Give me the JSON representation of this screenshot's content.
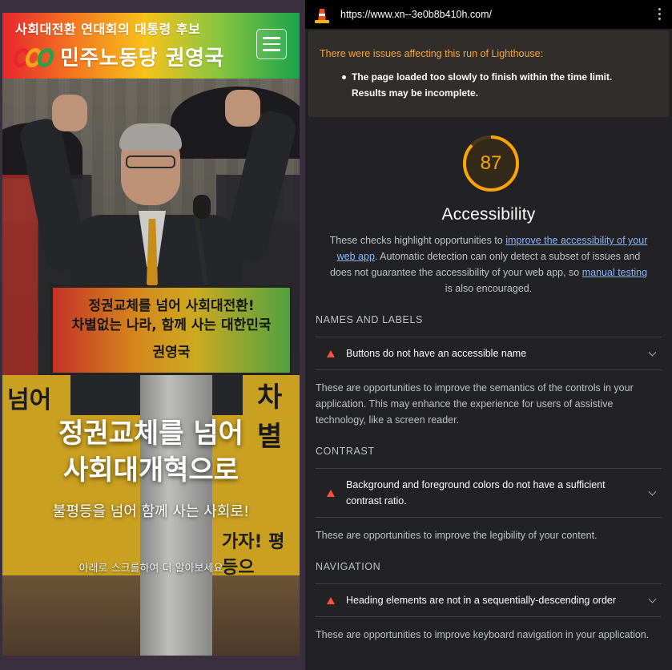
{
  "site": {
    "tagline": "사회대전환 연대회의 대통령 후보",
    "party_name": "민주노동당 권영국",
    "menu_label": "메뉴",
    "podium_line1": "정권교체를 넘어 사회대전환!",
    "podium_line2": "차별없는 나라, 함께 사는 대한민국",
    "podium_line3": "권영국",
    "banner_words": [
      "넘어",
      "차별",
      "평등",
      "가자! 평등으"
    ],
    "hero_title_line1": "정권교체를 넘어",
    "hero_title_line2": "사회대개혁으로",
    "hero_subtitle": "불평등을 넘어 함께 사는 사회로!",
    "scroll_hint": "아래로 스크롤하여 더 알아보세요",
    "brand_colors": [
      "#e8262d",
      "#f37021",
      "#f7c21a",
      "#8cc63f",
      "#1aa34a"
    ]
  },
  "lighthouse": {
    "url": "https://www.xn--3e0b8b410h.com/",
    "warning_title": "There were issues affecting this run of Lighthouse:",
    "warning_item": "The page loaded too slowly to finish within the time limit. Results may be incomplete.",
    "score": 87,
    "score_color": "#ffa400",
    "category_title": "Accessibility",
    "desc_part1": "These checks highlight opportunities to ",
    "desc_link1": "improve the accessibility of your web app",
    "desc_part2": ". Automatic detection can only detect a subset of issues and does not guarantee the accessibility of your web app, so ",
    "desc_link2": "manual testing",
    "desc_part3": " is also encouraged.",
    "groups": [
      {
        "title": "NAMES AND LABELS",
        "audit": "Buttons do not have an accessible name",
        "description": "These are opportunities to improve the semantics of the controls in your application. This may enhance the experience for users of assistive technology, like a screen reader."
      },
      {
        "title": "CONTRAST",
        "audit": "Background and foreground colors do not have a sufficient contrast ratio.",
        "description": "These are opportunities to improve the legibility of your content."
      },
      {
        "title": "NAVIGATION",
        "audit": "Heading elements are not in a sequentially-descending order",
        "description": "These are opportunities to improve keyboard navigation in your application."
      }
    ]
  }
}
